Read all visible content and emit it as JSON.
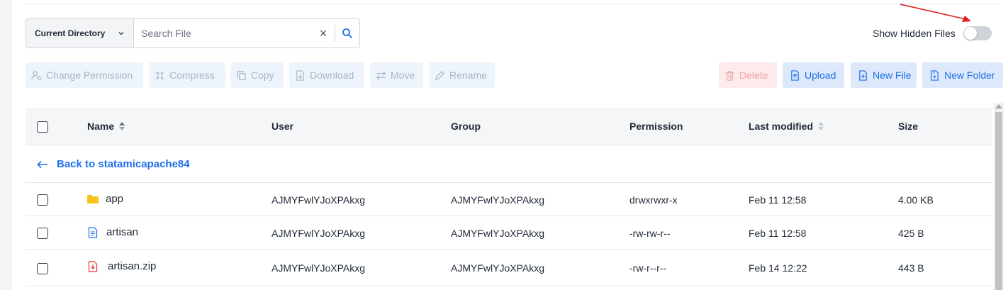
{
  "search": {
    "directory_scope": "Current Directory",
    "placeholder": "Search File",
    "value": "",
    "clear_glyph": "×",
    "search_icon": "magnifier-icon"
  },
  "hidden_files": {
    "label": "Show Hidden Files",
    "enabled": false
  },
  "toolbar": {
    "left": [
      {
        "label": "Change Permission",
        "icon": "user-key-icon",
        "enabled": false
      },
      {
        "label": "Compress",
        "icon": "compress-icon",
        "enabled": false
      },
      {
        "label": "Copy",
        "icon": "copy-icon",
        "enabled": false
      },
      {
        "label": "Download",
        "icon": "download-icon",
        "enabled": false
      },
      {
        "label": "Move",
        "icon": "move-arrows-icon",
        "enabled": false
      },
      {
        "label": "Rename",
        "icon": "pencil-icon",
        "enabled": false
      }
    ],
    "right": [
      {
        "label": "Delete",
        "icon": "trash-icon",
        "enabled": false
      },
      {
        "label": "Upload",
        "icon": "upload-file-icon",
        "enabled": true
      },
      {
        "label": "New File",
        "icon": "new-file-icon",
        "enabled": true
      },
      {
        "label": "New Folder",
        "icon": "new-folder-icon",
        "enabled": true
      }
    ]
  },
  "table": {
    "columns": [
      "Name",
      "User",
      "Group",
      "Permission",
      "Last modified",
      "Size"
    ],
    "back_link": "Back to statamicapache84",
    "rows": [
      {
        "name": "app",
        "type": "folder",
        "user": "AJMYFwlYJoXPAkxg",
        "group": "AJMYFwlYJoXPAkxg",
        "permission": "drwxrwxr-x",
        "modified": "Feb 11 12:58",
        "size": "4.00 KB"
      },
      {
        "name": "artisan",
        "type": "file",
        "user": "AJMYFwlYJoXPAkxg",
        "group": "AJMYFwlYJoXPAkxg",
        "permission": "-rw-rw-r--",
        "modified": "Feb 11 12:58",
        "size": "425 B"
      },
      {
        "name": "artisan.zip",
        "type": "archive",
        "user": "AJMYFwlYJoXPAkxg",
        "group": "AJMYFwlYJoXPAkxg",
        "permission": "-rw-r--r--",
        "modified": "Feb 14 12:22",
        "size": "443 B"
      }
    ]
  },
  "colors": {
    "accent": "#1f6feb",
    "folder": "#f5c518",
    "archive": "#e53935",
    "annotation": "#e11d1d"
  }
}
